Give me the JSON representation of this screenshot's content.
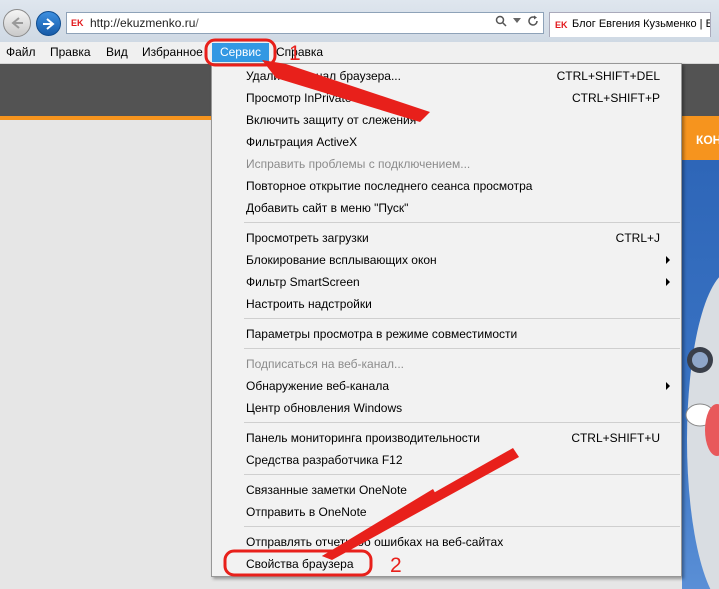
{
  "browser": {
    "url_host": "http://ekuzmenko.ru",
    "url_path": "/",
    "tab_title": "Блог Евгения Кузьменко | Бл",
    "favicon_text": "EK"
  },
  "menubar": {
    "items": [
      "Файл",
      "Правка",
      "Вид",
      "Избранное",
      "Сервис",
      "Справка"
    ]
  },
  "site": {
    "tab_text": "КОН"
  },
  "menu": {
    "items": [
      {
        "label": "Удалить журнал браузера...",
        "shortcut": "CTRL+SHIFT+DEL"
      },
      {
        "label": "Просмотр InPrivate",
        "shortcut": "CTRL+SHIFT+P"
      },
      {
        "label": "Включить защиту от слежения",
        "shortcut": ""
      },
      {
        "label": "Фильтрация ActiveX",
        "shortcut": ""
      },
      {
        "label": "Исправить проблемы с подключением...",
        "shortcut": "",
        "disabled": true
      },
      {
        "label": "Повторное открытие последнего сеанса просмотра",
        "shortcut": ""
      },
      {
        "label": "Добавить сайт в меню \"Пуск\"",
        "shortcut": ""
      },
      {
        "label": "Просмотреть загрузки",
        "shortcut": "CTRL+J"
      },
      {
        "label": "Блокирование всплывающих окон",
        "shortcut": "",
        "submenu": true
      },
      {
        "label": "Фильтр SmartScreen",
        "shortcut": "",
        "submenu": true
      },
      {
        "label": "Настроить надстройки",
        "shortcut": ""
      },
      {
        "label": "Параметры просмотра в режиме совместимости",
        "shortcut": ""
      },
      {
        "label": "Подписаться на веб-канал...",
        "shortcut": "",
        "disabled": true
      },
      {
        "label": "Обнаружение веб-канала",
        "shortcut": "",
        "submenu": true
      },
      {
        "label": "Центр обновления Windows",
        "shortcut": ""
      },
      {
        "label": "Панель мониторинга производительности",
        "shortcut": "CTRL+SHIFT+U"
      },
      {
        "label": "Средства разработчика F12",
        "shortcut": ""
      },
      {
        "label": "Связанные заметки OneNote",
        "shortcut": ""
      },
      {
        "label": "Отправить в OneNote",
        "shortcut": ""
      },
      {
        "label": "Отправлять отчеты об ошибках на веб-сайтах",
        "shortcut": ""
      },
      {
        "label": "Свойства браузера",
        "shortcut": ""
      }
    ]
  },
  "annotations": {
    "step1": "1",
    "step2": "2",
    "color": "#e8201b"
  }
}
